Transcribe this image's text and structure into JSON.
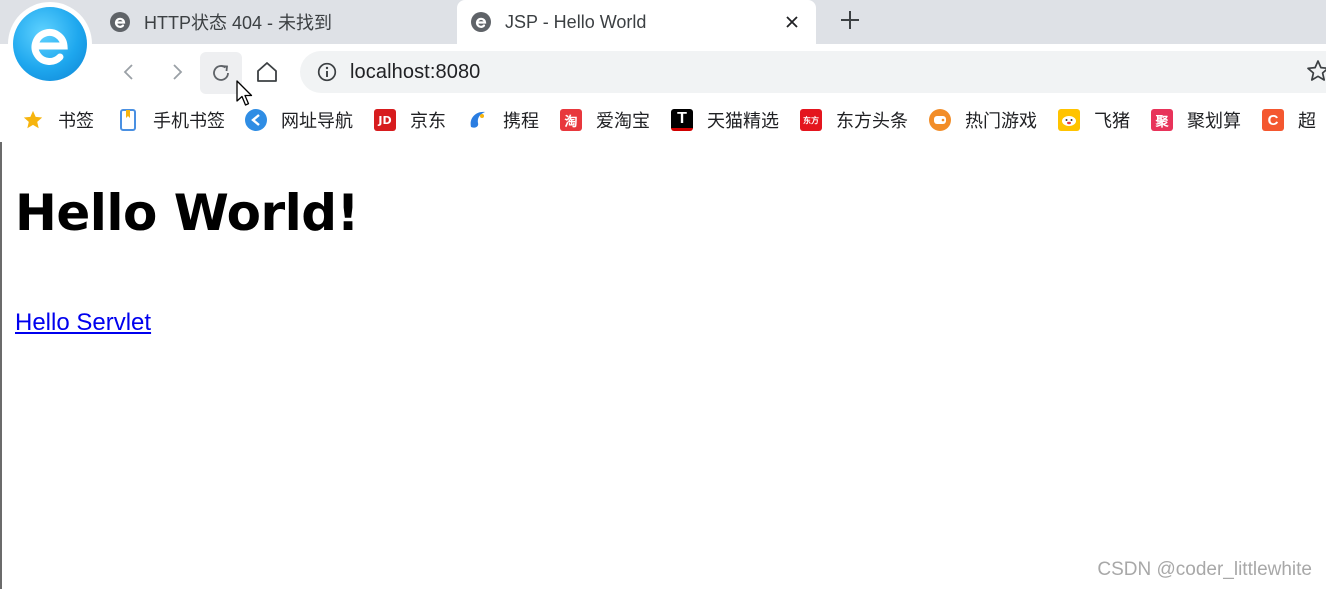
{
  "tabs": [
    {
      "title": "HTTP状态 404 - 未找到",
      "active": false
    },
    {
      "title": "JSP - Hello World",
      "active": true
    }
  ],
  "address_bar": {
    "url": "localhost:8080"
  },
  "bookmarks": [
    {
      "label": "书签",
      "icon": "star-icon",
      "color": "#f6b40e"
    },
    {
      "label": "手机书签",
      "icon": "phone-bookmark-icon",
      "color": "#4a90e2"
    },
    {
      "label": "网址导航",
      "icon": "navigation-icon",
      "color": "#2f8de4"
    },
    {
      "label": "京东",
      "icon": "jd-icon",
      "color": "#d71c1e"
    },
    {
      "label": "携程",
      "icon": "ctrip-icon",
      "color": "#2a7de1"
    },
    {
      "label": "爱淘宝",
      "icon": "taobao-icon",
      "color": "#e8383d"
    },
    {
      "label": "天猫精选",
      "icon": "tmall-icon",
      "color": "#d00000"
    },
    {
      "label": "东方头条",
      "icon": "dongfang-icon",
      "color": "#e4151e"
    },
    {
      "label": "热门游戏",
      "icon": "game-icon",
      "color": "#f28d28"
    },
    {
      "label": "飞猪",
      "icon": "fliggy-icon",
      "color": "#ffc300"
    },
    {
      "label": "聚划算",
      "icon": "juhuasuan-icon",
      "color": "#e8335a"
    },
    {
      "label": "超",
      "icon": "chao-icon",
      "color": "#f4572f"
    }
  ],
  "content": {
    "heading": "Hello World!",
    "link": "Hello Servlet"
  },
  "watermark": "CSDN @coder_littlewhite"
}
